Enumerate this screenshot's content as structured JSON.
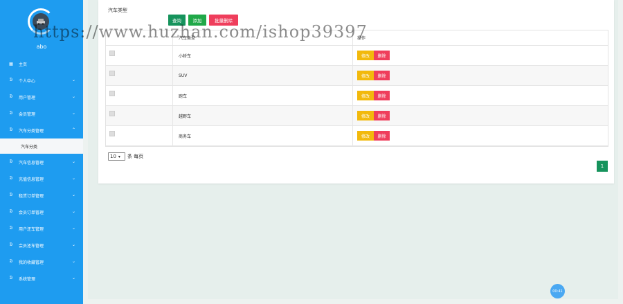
{
  "sidebar": {
    "username": "abo",
    "items": [
      {
        "icon": "grid-icon",
        "label": "主页",
        "chevron": ""
      },
      {
        "icon": "user-icon",
        "label": "个人中心",
        "chevron": "⌄"
      },
      {
        "icon": "user-icon",
        "label": "用户管理",
        "chevron": "⌄"
      },
      {
        "icon": "user-icon",
        "label": "会员管理",
        "chevron": "⌄"
      },
      {
        "icon": "user-icon",
        "label": "汽车分类管理",
        "chevron": "⌃"
      }
    ],
    "sub_item": "汽车分类",
    "items2": [
      {
        "icon": "user-icon",
        "label": "汽车信息管理",
        "chevron": "⌄"
      },
      {
        "icon": "user-icon",
        "label": "充值信息管理",
        "chevron": "⌄"
      },
      {
        "icon": "user-icon",
        "label": "租赁订单管理",
        "chevron": "⌄"
      },
      {
        "icon": "user-icon",
        "label": "会员订单管理",
        "chevron": "⌄"
      },
      {
        "icon": "user-icon",
        "label": "用户还车管理",
        "chevron": "⌄"
      },
      {
        "icon": "user-icon",
        "label": "会员还车管理",
        "chevron": "⌄"
      },
      {
        "icon": "user-icon",
        "label": "我的收藏管理",
        "chevron": "⌄"
      },
      {
        "icon": "user-icon",
        "label": "系统管理",
        "chevron": "⌄"
      }
    ]
  },
  "search": {
    "label": "汽车类型"
  },
  "toolbar": {
    "query": "查询",
    "add": "添加",
    "batch_delete": "批量删除"
  },
  "table": {
    "headers": [
      "",
      "汽车类型",
      "操作"
    ],
    "rows": [
      {
        "type": "小轿车"
      },
      {
        "type": "SUV"
      },
      {
        "type": "跑车"
      },
      {
        "type": "越野车"
      },
      {
        "type": "商务车"
      }
    ],
    "edit_label": "修改",
    "delete_label": "删除"
  },
  "pagination": {
    "page_size": "10",
    "per_page_text": "条 每页",
    "current_page": "1"
  },
  "float_button": "00:41",
  "watermark": "https://www.huzhan.com/ishop39397",
  "colors": {
    "sidebar": "#1e9cf0",
    "primary": "#16935c",
    "danger": "#ef3e5c",
    "warning": "#f2b90c"
  }
}
